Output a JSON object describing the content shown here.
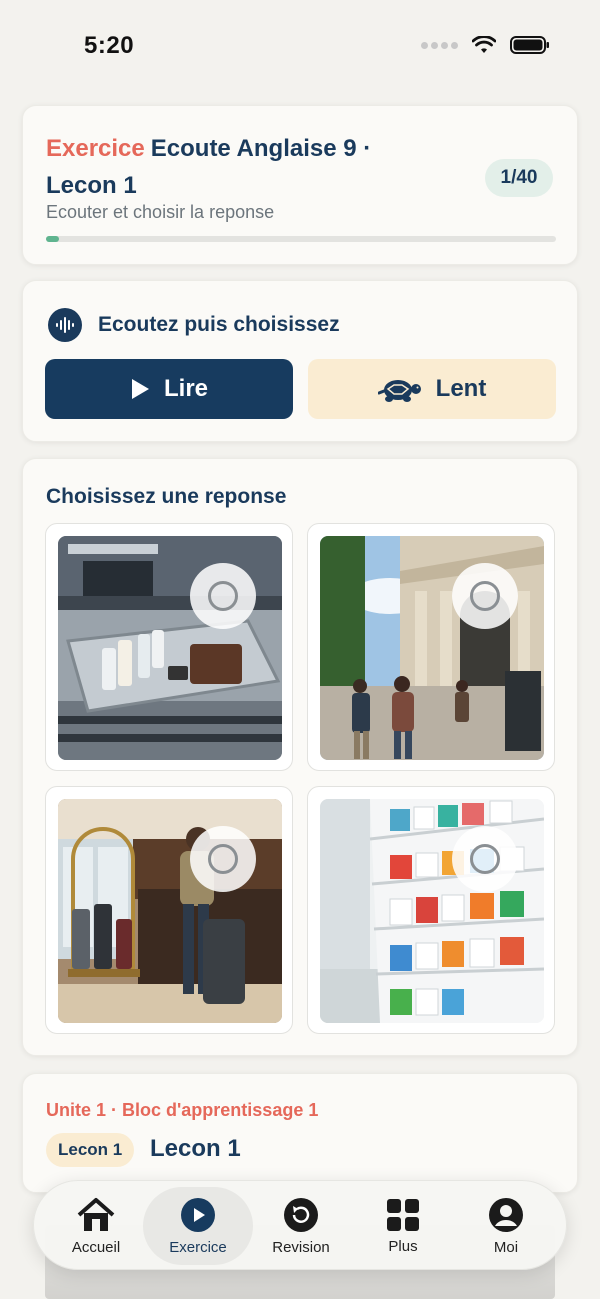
{
  "status_bar": {
    "time": "5:20"
  },
  "header": {
    "label": "Exercice",
    "title": "Ecoute Anglaise 9 · Lecon 1",
    "counter": "1/40",
    "subtitle": "Ecouter et choisir la reponse",
    "progress_fraction": 0.025
  },
  "listen": {
    "title": "Ecoutez puis choisissez",
    "play_label": "Lire",
    "slow_label": "Lent"
  },
  "choices": {
    "title": "Choisissez une reponse",
    "options": [
      {
        "image": "airport-security-tray"
      },
      {
        "image": "museum-steps-tourists"
      },
      {
        "image": "hotel-lobby-checkin"
      },
      {
        "image": "pharmacy-shelves"
      }
    ]
  },
  "unit": {
    "label": "Unite 1 · Bloc d'apprentissage 1",
    "lesson_badge": "Lecon 1",
    "lesson_title": "Lecon 1"
  },
  "nav": {
    "items": [
      {
        "label": "Accueil",
        "icon": "home-icon"
      },
      {
        "label": "Exercice",
        "icon": "play-circle-icon",
        "active": true
      },
      {
        "label": "Revision",
        "icon": "refresh-icon"
      },
      {
        "label": "Plus",
        "icon": "grid-icon"
      },
      {
        "label": "Moi",
        "icon": "user-icon"
      }
    ]
  },
  "colors": {
    "accent": "#e5685a",
    "primary": "#173b5f",
    "slow_button": "#faecd2",
    "progress": "#5fb48f"
  }
}
